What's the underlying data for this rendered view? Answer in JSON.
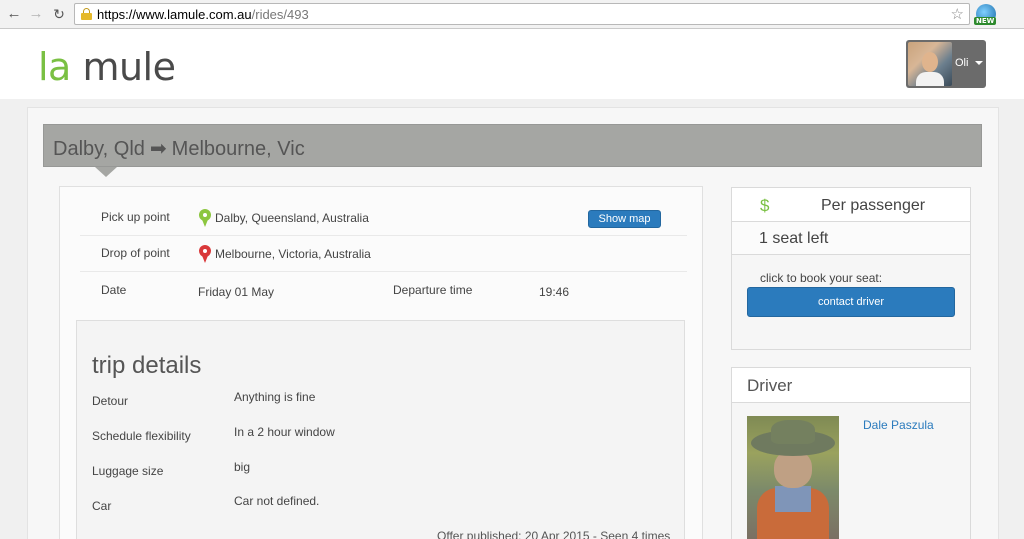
{
  "browser": {
    "url_host": "https://www.lamule.com.au",
    "url_path": "/rides/493",
    "extension_badge": "NEW"
  },
  "header": {
    "logo_la": "la",
    "logo_mule": "mule",
    "user_name": "Oli"
  },
  "route": {
    "from": "Dalby, Qld",
    "arrow": "➡",
    "to": "Melbourne, Vic"
  },
  "ride": {
    "pickup_label": "Pick up point",
    "pickup_value": "Dalby, Queensland, Australia",
    "show_map_label": "Show map",
    "dropoff_label": "Drop of point",
    "dropoff_value": "Melbourne, Victoria, Australia",
    "date_label": "Date",
    "date_value": "Friday 01 May",
    "departure_label": "Departure time",
    "departure_value": "19:46"
  },
  "trip_details": {
    "title": "trip details",
    "rows": [
      {
        "label": "Detour",
        "value": "Anything is fine"
      },
      {
        "label": "Schedule flexibility",
        "value": "In a 2 hour window"
      },
      {
        "label": "Luggage size",
        "value": "big"
      },
      {
        "label": "Car",
        "value": "Car not defined."
      }
    ],
    "offer_info": "Offer published: 20 Apr 2015 - Seen 4 times"
  },
  "booking": {
    "currency_symbol": "$",
    "price_label": "Per passenger",
    "seats_left": "1 seat left",
    "book_prompt": "click to book your seat:",
    "contact_label": "contact driver"
  },
  "driver": {
    "title": "Driver",
    "name": "Dale Paszula"
  },
  "colors": {
    "brand_green": "#7ac043",
    "primary_blue": "#2b7bbd",
    "banner_gray": "#a5a6a3",
    "pin_green": "#8cc63f",
    "pin_red": "#d9383a"
  },
  "icons": [
    "back-arrow-icon",
    "forward-arrow-icon",
    "reload-icon",
    "lock-icon",
    "bookmark-star-icon",
    "extension-icon",
    "caret-down-icon",
    "green-map-pin-icon",
    "red-map-pin-icon",
    "dollar-icon",
    "route-arrow-icon"
  ]
}
